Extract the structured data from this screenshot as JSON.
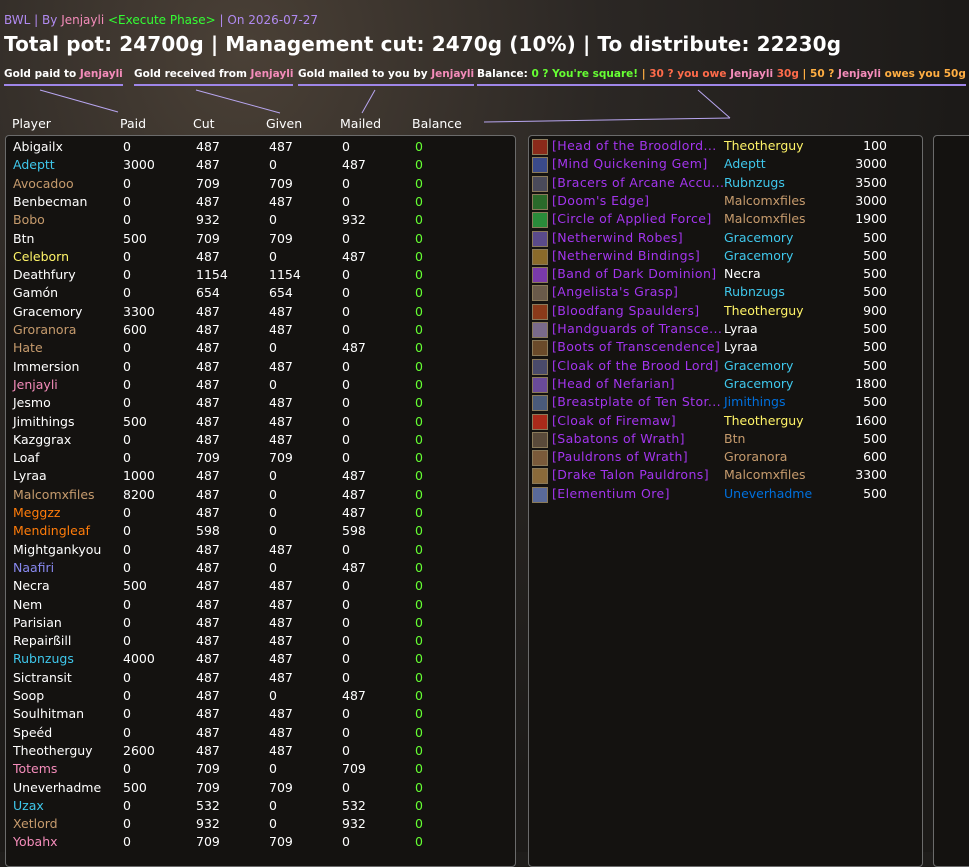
{
  "colors": {
    "Druid": "#ff7c0a",
    "Hunter": "#aad372",
    "Mage": "#3fc7eb",
    "Paladin": "#f48cba",
    "Priest": "#ffffff",
    "Rogue": "#fff468",
    "Shaman": "#0070dd",
    "Warlock": "#8788ee",
    "Warrior": "#c69b6d",
    "Epic": "#a335ee",
    "Balance": "#66ff33"
  },
  "header": {
    "raid": "BWL",
    "by": " | By ",
    "leader": "Jenjayli",
    "phase": " <Execute Phase>",
    "date": " | On 2026-07-27"
  },
  "summary": {
    "text": "Total pot: 24700g | Management cut: 2470g (10%) | To distribute: 22230g"
  },
  "legend": {
    "paid_prefix": "Gold paid to ",
    "received_prefix": "Gold received from ",
    "mailed_prefix": "Gold mailed to you by ",
    "name": "Jenjayli",
    "balance_label": "Balance: ",
    "bal_square": "0 ? You're square!",
    "sep1": " | ",
    "bal_owe": "30 ? you owe ",
    "bal_owe_amt": " 30g",
    "sep2": " | ",
    "bal_owed": "50 ? ",
    "bal_owed_txt": " owes you 50g"
  },
  "columns": {
    "player": "Player",
    "paid": "Paid",
    "cut": "Cut",
    "given": "Given",
    "mailed": "Mailed",
    "balance": "Balance"
  },
  "players": [
    {
      "name": "Abigailx",
      "cls": "Priest",
      "paid": "0",
      "cut": "487",
      "given": "487",
      "mailed": "0",
      "balance": "0"
    },
    {
      "name": "Adeptt",
      "cls": "Mage",
      "paid": "3000",
      "cut": "487",
      "given": "0",
      "mailed": "487",
      "balance": "0"
    },
    {
      "name": "Avocadoo",
      "cls": "Warrior",
      "paid": "0",
      "cut": "709",
      "given": "709",
      "mailed": "0",
      "balance": "0"
    },
    {
      "name": "Benbecman",
      "cls": "Priest",
      "paid": "0",
      "cut": "487",
      "given": "487",
      "mailed": "0",
      "balance": "0"
    },
    {
      "name": "Bobo",
      "cls": "Warrior",
      "paid": "0",
      "cut": "932",
      "given": "0",
      "mailed": "932",
      "balance": "0"
    },
    {
      "name": "Btn",
      "cls": "Priest",
      "paid": "500",
      "cut": "709",
      "given": "709",
      "mailed": "0",
      "balance": "0"
    },
    {
      "name": "Celeborn",
      "cls": "Rogue",
      "paid": "0",
      "cut": "487",
      "given": "0",
      "mailed": "487",
      "balance": "0"
    },
    {
      "name": "Deathfury",
      "cls": "Priest",
      "paid": "0",
      "cut": "1154",
      "given": "1154",
      "mailed": "0",
      "balance": "0"
    },
    {
      "name": "Gamón",
      "cls": "Priest",
      "paid": "0",
      "cut": "654",
      "given": "654",
      "mailed": "0",
      "balance": "0"
    },
    {
      "name": "Gracemory",
      "cls": "Priest",
      "paid": "3300",
      "cut": "487",
      "given": "487",
      "mailed": "0",
      "balance": "0"
    },
    {
      "name": "Groranora",
      "cls": "Warrior",
      "paid": "600",
      "cut": "487",
      "given": "487",
      "mailed": "0",
      "balance": "0"
    },
    {
      "name": "Hate",
      "cls": "Warrior",
      "paid": "0",
      "cut": "487",
      "given": "0",
      "mailed": "487",
      "balance": "0"
    },
    {
      "name": "Immersion",
      "cls": "Priest",
      "paid": "0",
      "cut": "487",
      "given": "487",
      "mailed": "0",
      "balance": "0"
    },
    {
      "name": "Jenjayli",
      "cls": "Paladin",
      "paid": "0",
      "cut": "487",
      "given": "0",
      "mailed": "0",
      "balance": "0"
    },
    {
      "name": "Jesmo",
      "cls": "Priest",
      "paid": "0",
      "cut": "487",
      "given": "487",
      "mailed": "0",
      "balance": "0"
    },
    {
      "name": "Jimithings",
      "cls": "Priest",
      "paid": "500",
      "cut": "487",
      "given": "487",
      "mailed": "0",
      "balance": "0"
    },
    {
      "name": "Kazggrax",
      "cls": "Priest",
      "paid": "0",
      "cut": "487",
      "given": "487",
      "mailed": "0",
      "balance": "0"
    },
    {
      "name": "Loaf",
      "cls": "Priest",
      "paid": "0",
      "cut": "709",
      "given": "709",
      "mailed": "0",
      "balance": "0"
    },
    {
      "name": "Lyraa",
      "cls": "Priest",
      "paid": "1000",
      "cut": "487",
      "given": "0",
      "mailed": "487",
      "balance": "0"
    },
    {
      "name": "Malcomxfiles",
      "cls": "Warrior",
      "paid": "8200",
      "cut": "487",
      "given": "0",
      "mailed": "487",
      "balance": "0"
    },
    {
      "name": "Meggzz",
      "cls": "Druid",
      "paid": "0",
      "cut": "487",
      "given": "0",
      "mailed": "487",
      "balance": "0"
    },
    {
      "name": "Mendingleaf",
      "cls": "Druid",
      "paid": "0",
      "cut": "598",
      "given": "0",
      "mailed": "598",
      "balance": "0"
    },
    {
      "name": "Mightgankyou",
      "cls": "Priest",
      "paid": "0",
      "cut": "487",
      "given": "487",
      "mailed": "0",
      "balance": "0"
    },
    {
      "name": "Naafiri",
      "cls": "Warlock",
      "paid": "0",
      "cut": "487",
      "given": "0",
      "mailed": "487",
      "balance": "0"
    },
    {
      "name": "Necra",
      "cls": "Priest",
      "paid": "500",
      "cut": "487",
      "given": "487",
      "mailed": "0",
      "balance": "0"
    },
    {
      "name": "Nem",
      "cls": "Priest",
      "paid": "0",
      "cut": "487",
      "given": "487",
      "mailed": "0",
      "balance": "0"
    },
    {
      "name": "Parisian",
      "cls": "Priest",
      "paid": "0",
      "cut": "487",
      "given": "487",
      "mailed": "0",
      "balance": "0"
    },
    {
      "name": "Repairßill",
      "cls": "Priest",
      "paid": "0",
      "cut": "487",
      "given": "487",
      "mailed": "0",
      "balance": "0"
    },
    {
      "name": "Rubnzugs",
      "cls": "Mage",
      "paid": "4000",
      "cut": "487",
      "given": "487",
      "mailed": "0",
      "balance": "0"
    },
    {
      "name": "Sictransit",
      "cls": "Priest",
      "paid": "0",
      "cut": "487",
      "given": "487",
      "mailed": "0",
      "balance": "0"
    },
    {
      "name": "Soop",
      "cls": "Priest",
      "paid": "0",
      "cut": "487",
      "given": "0",
      "mailed": "487",
      "balance": "0"
    },
    {
      "name": "Soulhitman",
      "cls": "Priest",
      "paid": "0",
      "cut": "487",
      "given": "487",
      "mailed": "0",
      "balance": "0"
    },
    {
      "name": "Speéd",
      "cls": "Priest",
      "paid": "0",
      "cut": "487",
      "given": "487",
      "mailed": "0",
      "balance": "0"
    },
    {
      "name": "Theotherguy",
      "cls": "Priest",
      "paid": "2600",
      "cut": "487",
      "given": "487",
      "mailed": "0",
      "balance": "0"
    },
    {
      "name": "Totems",
      "cls": "Paladin",
      "paid": "0",
      "cut": "709",
      "given": "0",
      "mailed": "709",
      "balance": "0"
    },
    {
      "name": "Uneverhadme",
      "cls": "Priest",
      "paid": "500",
      "cut": "709",
      "given": "709",
      "mailed": "0",
      "balance": "0"
    },
    {
      "name": "Uzax",
      "cls": "Mage",
      "paid": "0",
      "cut": "532",
      "given": "0",
      "mailed": "532",
      "balance": "0"
    },
    {
      "name": "Xetlord",
      "cls": "Warrior",
      "paid": "0",
      "cut": "932",
      "given": "0",
      "mailed": "932",
      "balance": "0"
    },
    {
      "name": "Yobahx",
      "cls": "Paladin",
      "paid": "0",
      "cut": "709",
      "given": "709",
      "mailed": "0",
      "balance": "0"
    }
  ],
  "items": [
    {
      "name": "[Head of the Broodlord...",
      "buyer": "Theotherguy",
      "cls": "Rogue",
      "price": "100",
      "icon": "#8a2a1a"
    },
    {
      "name": "[Mind Quickening Gem]",
      "buyer": "Adeptt",
      "cls": "Mage",
      "price": "3000",
      "icon": "#3a4a8a"
    },
    {
      "name": "[Bracers of Arcane Accu...",
      "buyer": "Rubnzugs",
      "cls": "Mage",
      "price": "3500",
      "icon": "#4a4a5a"
    },
    {
      "name": "[Doom's Edge]",
      "buyer": "Malcomxfiles",
      "cls": "Warrior",
      "price": "3000",
      "icon": "#2a6a2a"
    },
    {
      "name": "[Circle of Applied Force]",
      "buyer": "Malcomxfiles",
      "cls": "Warrior",
      "price": "1900",
      "icon": "#2a8a3a"
    },
    {
      "name": "[Netherwind Robes]",
      "buyer": "Gracemory",
      "cls": "Mage",
      "price": "500",
      "icon": "#5a4a8a"
    },
    {
      "name": "[Netherwind Bindings]",
      "buyer": "Gracemory",
      "cls": "Mage",
      "price": "500",
      "icon": "#8a6a2a"
    },
    {
      "name": "[Band of Dark Dominion]",
      "buyer": "Necra",
      "cls": "Priest",
      "price": "500",
      "icon": "#7a3aaa"
    },
    {
      "name": "[Angelista's Grasp]",
      "buyer": "Rubnzugs",
      "cls": "Mage",
      "price": "500",
      "icon": "#6a5a4a"
    },
    {
      "name": "[Bloodfang Spaulders]",
      "buyer": "Theotherguy",
      "cls": "Rogue",
      "price": "900",
      "icon": "#8a3a1a"
    },
    {
      "name": "[Handguards of Transce...",
      "buyer": "Lyraa",
      "cls": "Priest",
      "price": "500",
      "icon": "#7a6a8a"
    },
    {
      "name": "[Boots of Transcendence]",
      "buyer": "Lyraa",
      "cls": "Priest",
      "price": "500",
      "icon": "#6a4a2a"
    },
    {
      "name": "[Cloak of the Brood Lord]",
      "buyer": "Gracemory",
      "cls": "Mage",
      "price": "500",
      "icon": "#4a4a6a"
    },
    {
      "name": "[Head of Nefarian]",
      "buyer": "Gracemory",
      "cls": "Mage",
      "price": "1800",
      "icon": "#6a4a9a"
    },
    {
      "name": "[Breastplate of Ten Stor...",
      "buyer": "Jimithings",
      "cls": "Shaman",
      "price": "500",
      "icon": "#4a5a7a"
    },
    {
      "name": "[Cloak of Firemaw]",
      "buyer": "Theotherguy",
      "cls": "Rogue",
      "price": "1600",
      "icon": "#aa2a1a"
    },
    {
      "name": "[Sabatons of Wrath]",
      "buyer": "Btn",
      "cls": "Warrior",
      "price": "500",
      "icon": "#5a4a3a"
    },
    {
      "name": "[Pauldrons of Wrath]",
      "buyer": "Groranora",
      "cls": "Warrior",
      "price": "600",
      "icon": "#7a5a3a"
    },
    {
      "name": "[Drake Talon Pauldrons]",
      "buyer": "Malcomxfiles",
      "cls": "Warrior",
      "price": "3300",
      "icon": "#8a6a3a"
    },
    {
      "name": "[Elementium Ore]",
      "buyer": "Uneverhadme",
      "cls": "Shaman",
      "price": "500",
      "icon": "#5a6a9a"
    }
  ]
}
